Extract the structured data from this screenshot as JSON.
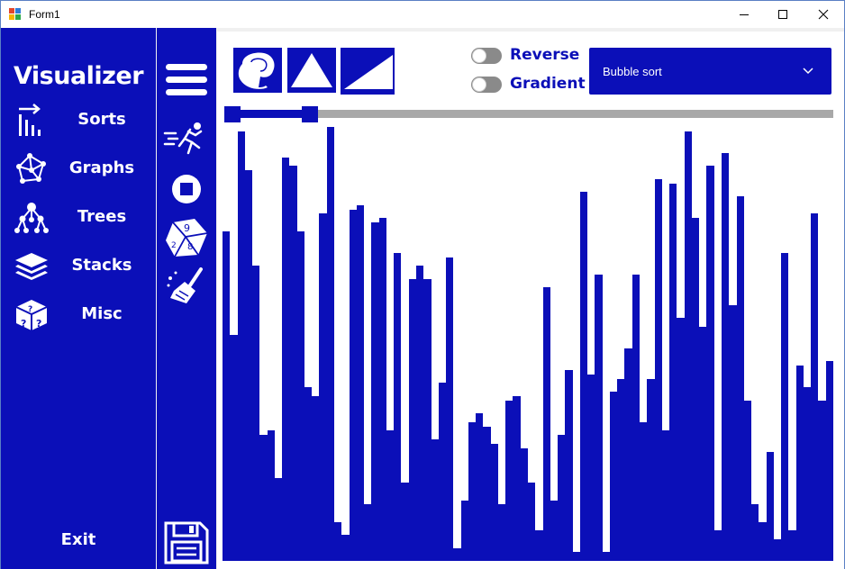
{
  "window": {
    "title": "Form1"
  },
  "nav": {
    "title": "Visualizer",
    "items": [
      {
        "label": "Sorts",
        "icon": "sort-bars-icon"
      },
      {
        "label": "Graphs",
        "icon": "graph-network-icon"
      },
      {
        "label": "Trees",
        "icon": "tree-nodes-icon"
      },
      {
        "label": "Stacks",
        "icon": "layers-icon"
      },
      {
        "label": "Misc",
        "icon": "mystery-box-icon"
      }
    ],
    "exit_label": "Exit"
  },
  "toolbar": {
    "tools": [
      "menu-icon",
      "run-icon",
      "stop-icon",
      "dice-icon",
      "broom-icon",
      "save-icon"
    ]
  },
  "options": {
    "reverse_label": "Reverse",
    "reverse_on": false,
    "gradient_label": "Gradient",
    "gradient_on": false,
    "algorithm": "Bubble sort",
    "speed_level": 0.13
  },
  "colors": {
    "accent": "#0b0fb8",
    "track": "#a8a8a8",
    "toggle_off": "#8a8a8a"
  },
  "chart_data": {
    "type": "bar",
    "values": [
      76,
      52,
      99,
      90,
      68,
      29,
      30,
      19,
      93,
      91,
      76,
      40,
      38,
      80,
      100,
      9,
      6,
      81,
      82,
      13,
      78,
      79,
      30,
      71,
      18,
      65,
      68,
      65,
      28,
      41,
      70,
      3,
      14,
      32,
      34,
      31,
      27,
      13,
      37,
      38,
      26,
      18,
      7,
      63,
      14,
      29,
      44,
      2,
      85,
      43,
      66,
      2,
      39,
      42,
      49,
      66,
      32,
      42,
      88,
      30,
      87,
      56,
      99,
      79,
      54,
      91,
      7,
      94,
      59,
      84,
      37,
      13,
      9,
      25,
      5,
      71,
      7,
      45,
      40,
      80,
      37,
      46
    ]
  }
}
